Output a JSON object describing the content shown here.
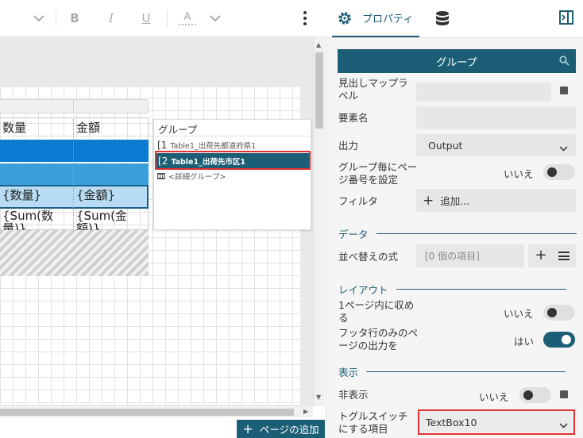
{
  "toolbar": {
    "bold": "B",
    "italic": "I",
    "underline": "U",
    "font_color": "A"
  },
  "table": {
    "headers": [
      "数量",
      "金額"
    ],
    "detail_row": [
      "{数量}",
      "{金額}"
    ],
    "total_row": [
      "{Sum(数量)}",
      "{Sum(金額)}"
    ]
  },
  "groups_panel": {
    "title": "グループ",
    "items": [
      {
        "number": "1",
        "label": "Table1_出荷先都道府県1"
      },
      {
        "number": "2",
        "label": "Table1_出荷先市区1"
      },
      {
        "number": "",
        "label": "<詳細グループ>"
      }
    ]
  },
  "canvas_ghost_text": "金額",
  "add_page_button": "ページの追加",
  "props": {
    "tab_label": "プロパティ",
    "header_title": "グループ",
    "rows": {
      "caption_label": "見出しマップラベル",
      "element_name_label": "要素名",
      "output_label": "出力",
      "output_value": "Output",
      "page_number_label": "グループ毎にページ番号を設定",
      "page_number_value": "いいえ",
      "filter_label": "フィルタ",
      "filter_add": "追加...",
      "sort_label": "並べ替えの式",
      "sort_value": "[0 個の項目]",
      "fit_page_label": "1ページ内に収める",
      "fit_page_value": "いいえ",
      "footer_only_label": "フッタ行のみのページの出力を",
      "footer_only_value": "はい",
      "hidden_label": "非表示",
      "hidden_value": "いいえ",
      "toggle_item_label": "トグルスイッチにする項目",
      "toggle_item_value": "TextBox10"
    },
    "sections": {
      "data": "データ",
      "layout": "レイアウト",
      "display": "表示"
    }
  },
  "colors": {
    "primary": "#1b5e75",
    "table_band_dark": "#0b7bd1",
    "table_band_mid": "#3aa0dc",
    "table_band_light": "#b8dcf3",
    "highlight": "#e03030"
  }
}
